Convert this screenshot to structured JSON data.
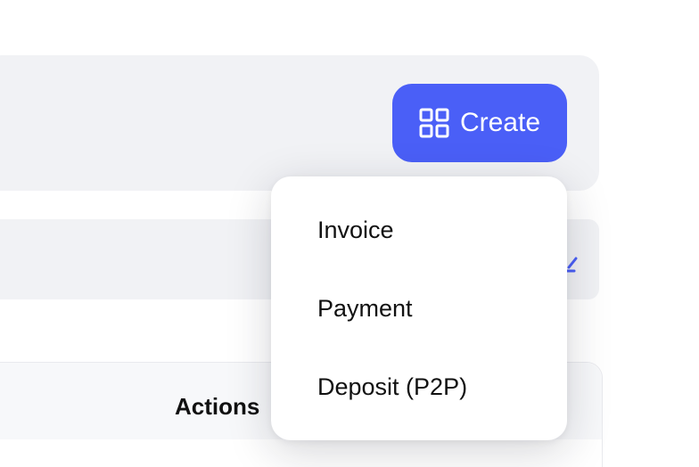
{
  "header": {
    "create_button": {
      "label": "Create",
      "icon": "grid-icon",
      "color": "#4a5ff7"
    }
  },
  "create_menu": {
    "items": [
      {
        "label": "Invoice"
      },
      {
        "label": "Payment"
      },
      {
        "label": "Deposit (P2P)"
      }
    ]
  },
  "filter_bar": {
    "icon": "edit-icon"
  },
  "table": {
    "columns": {
      "actions": "Actions"
    }
  }
}
